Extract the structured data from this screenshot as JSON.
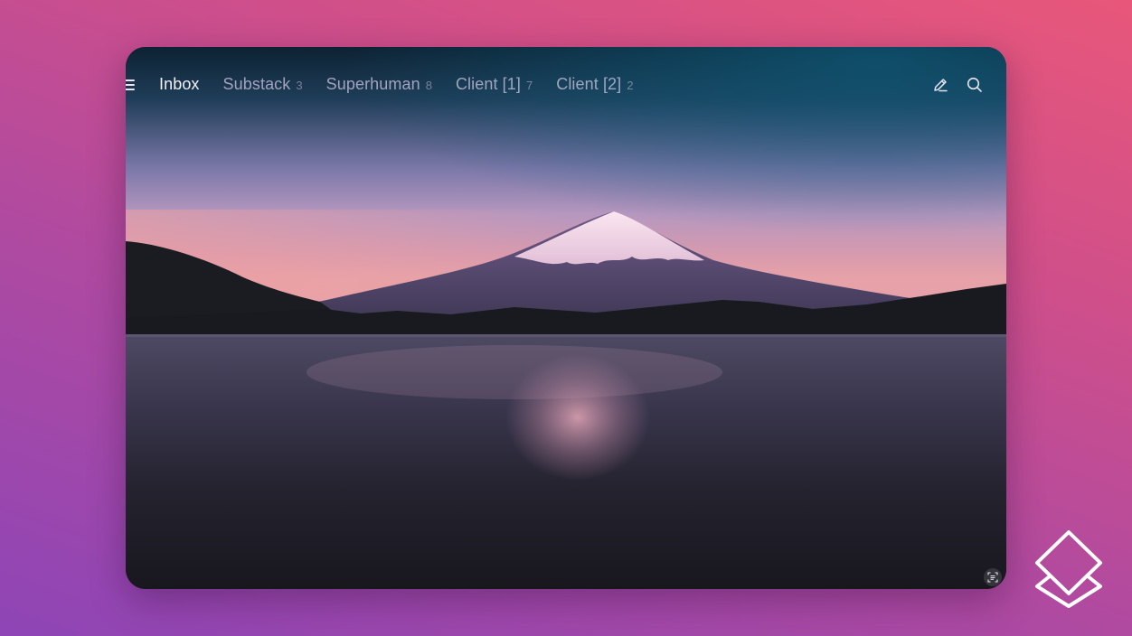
{
  "tabs": [
    {
      "label": "Inbox",
      "count": "",
      "active": true
    },
    {
      "label": "Substack",
      "count": "3",
      "active": false
    },
    {
      "label": "Superhuman",
      "count": "8",
      "active": false
    },
    {
      "label": "Client [1]",
      "count": "7",
      "active": false
    },
    {
      "label": "Client [2]",
      "count": "2",
      "active": false
    }
  ],
  "icons": {
    "menu": "hamburger-menu-icon",
    "compose": "pencil-icon",
    "search": "magnifier-icon",
    "corner": "screen-text-icon",
    "brand": "layers-logo-icon"
  },
  "colors": {
    "background_top_right": "#e8577a",
    "background_bottom_left": "#8e45b6",
    "active_tab_text": "#f3f0f7",
    "inactive_tab_text": "#b8acc8"
  }
}
